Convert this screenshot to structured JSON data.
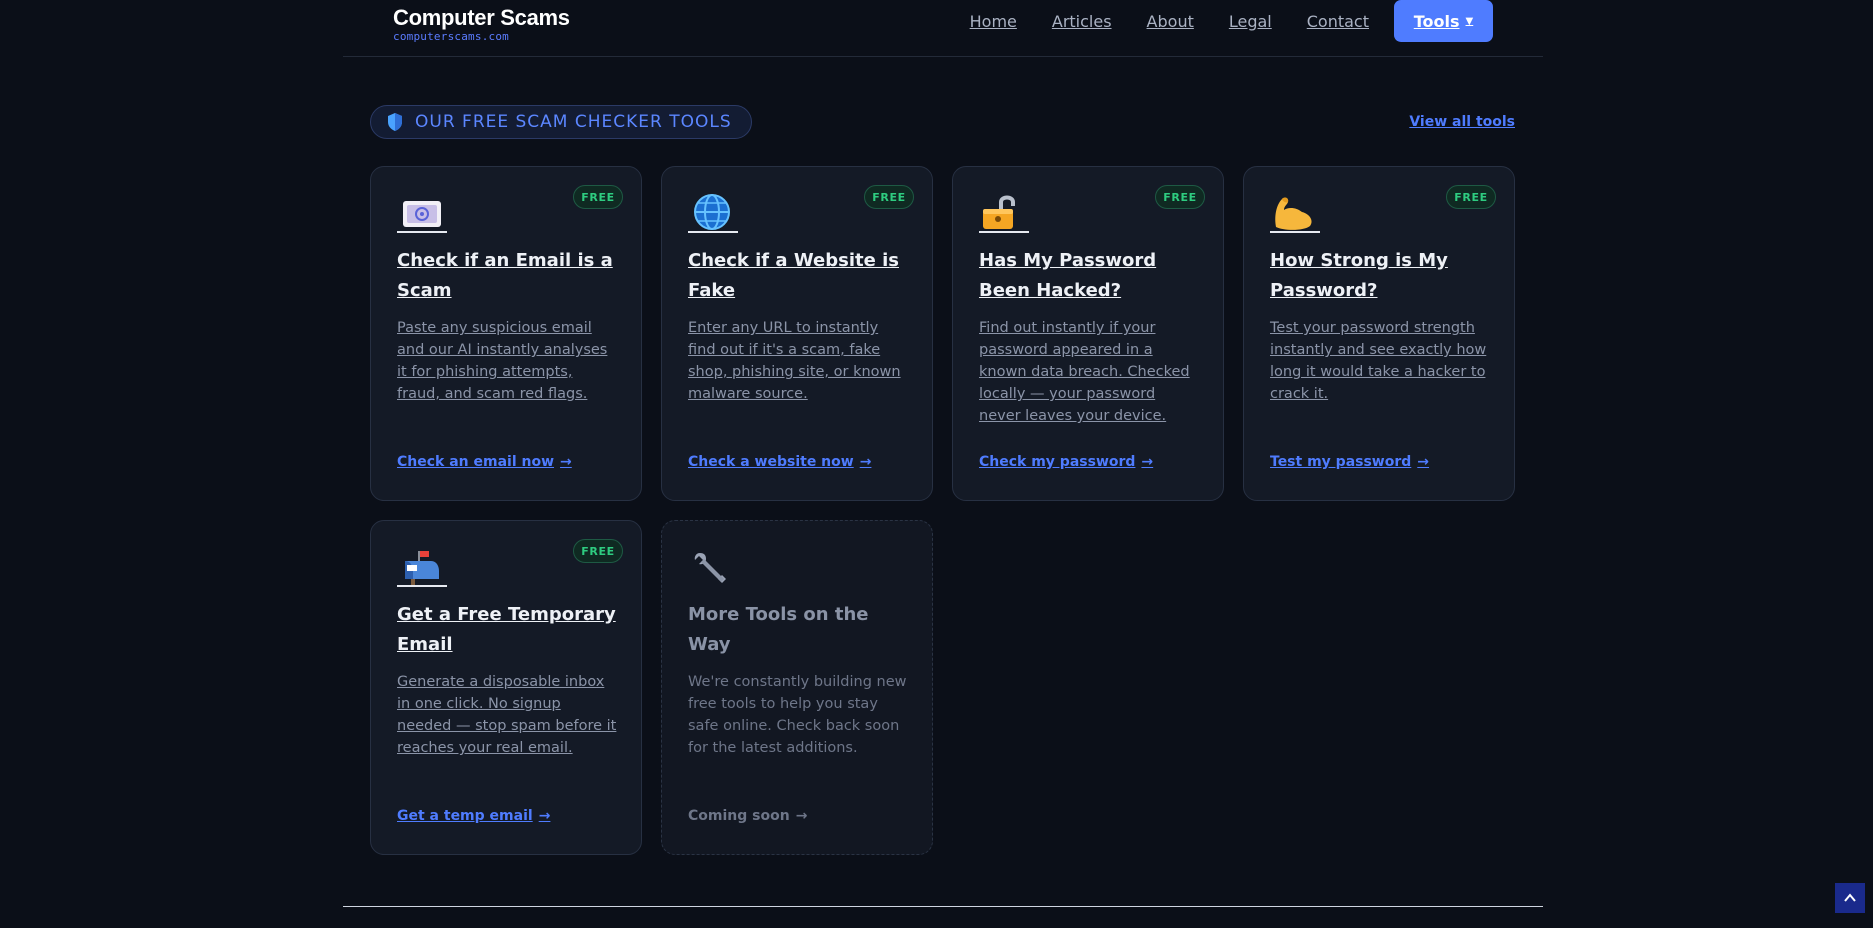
{
  "header": {
    "brand_name": "Computer Scams",
    "brand_domain": "computerscams.com",
    "nav": [
      "Home",
      "Articles",
      "About",
      "Legal",
      "Contact"
    ],
    "tools_label": "Tools",
    "tools_caret": "▼"
  },
  "section": {
    "heading": "OUR FREE SCAM CHECKER TOOLS",
    "view_all": "View all tools"
  },
  "cards": [
    {
      "badge": "FREE",
      "icon": "email-icon",
      "title": "Check if an Email is a Scam",
      "desc": "Paste any suspicious email and our AI instantly analyses it for phishing attempts, fraud, and scam red flags.",
      "cta": "Check an email now",
      "arrow": "→"
    },
    {
      "badge": "FREE",
      "icon": "globe-icon",
      "title": "Check if a Website is Fake",
      "desc": "Enter any URL to instantly find out if it's a scam, fake shop, phishing site, or known malware source.",
      "cta": "Check a website now",
      "arrow": "→"
    },
    {
      "badge": "FREE",
      "icon": "unlocked-padlock-icon",
      "title": "Has My Password Been Hacked?",
      "desc": "Find out instantly if your password appeared in a known data breach. Checked locally — your password never leaves your device.",
      "cta": "Check my password",
      "arrow": "→"
    },
    {
      "badge": "FREE",
      "icon": "flexed-bicep-icon",
      "title": "How Strong is My Password?",
      "desc": "Test your password strength instantly and see exactly how long it would take a hacker to crack it.",
      "cta": "Test my password",
      "arrow": "→"
    },
    {
      "badge": "FREE",
      "icon": "mailbox-icon",
      "title": "Get a Free Temporary Email",
      "desc": "Generate a disposable inbox in one click. No signup needed — stop spam before it reaches your real email.",
      "cta": "Get a temp email",
      "arrow": "→"
    },
    {
      "icon": "wrench-icon",
      "title": "More Tools on the Way",
      "desc": "We're constantly building new free tools to help you stay safe online. Check back soon for the latest additions.",
      "cta": "Coming soon",
      "arrow": "→"
    }
  ],
  "colors": {
    "accent": "#4f7cff",
    "badge_green": "#2ecc80",
    "background": "#0b0f18",
    "card": "#141a26"
  }
}
